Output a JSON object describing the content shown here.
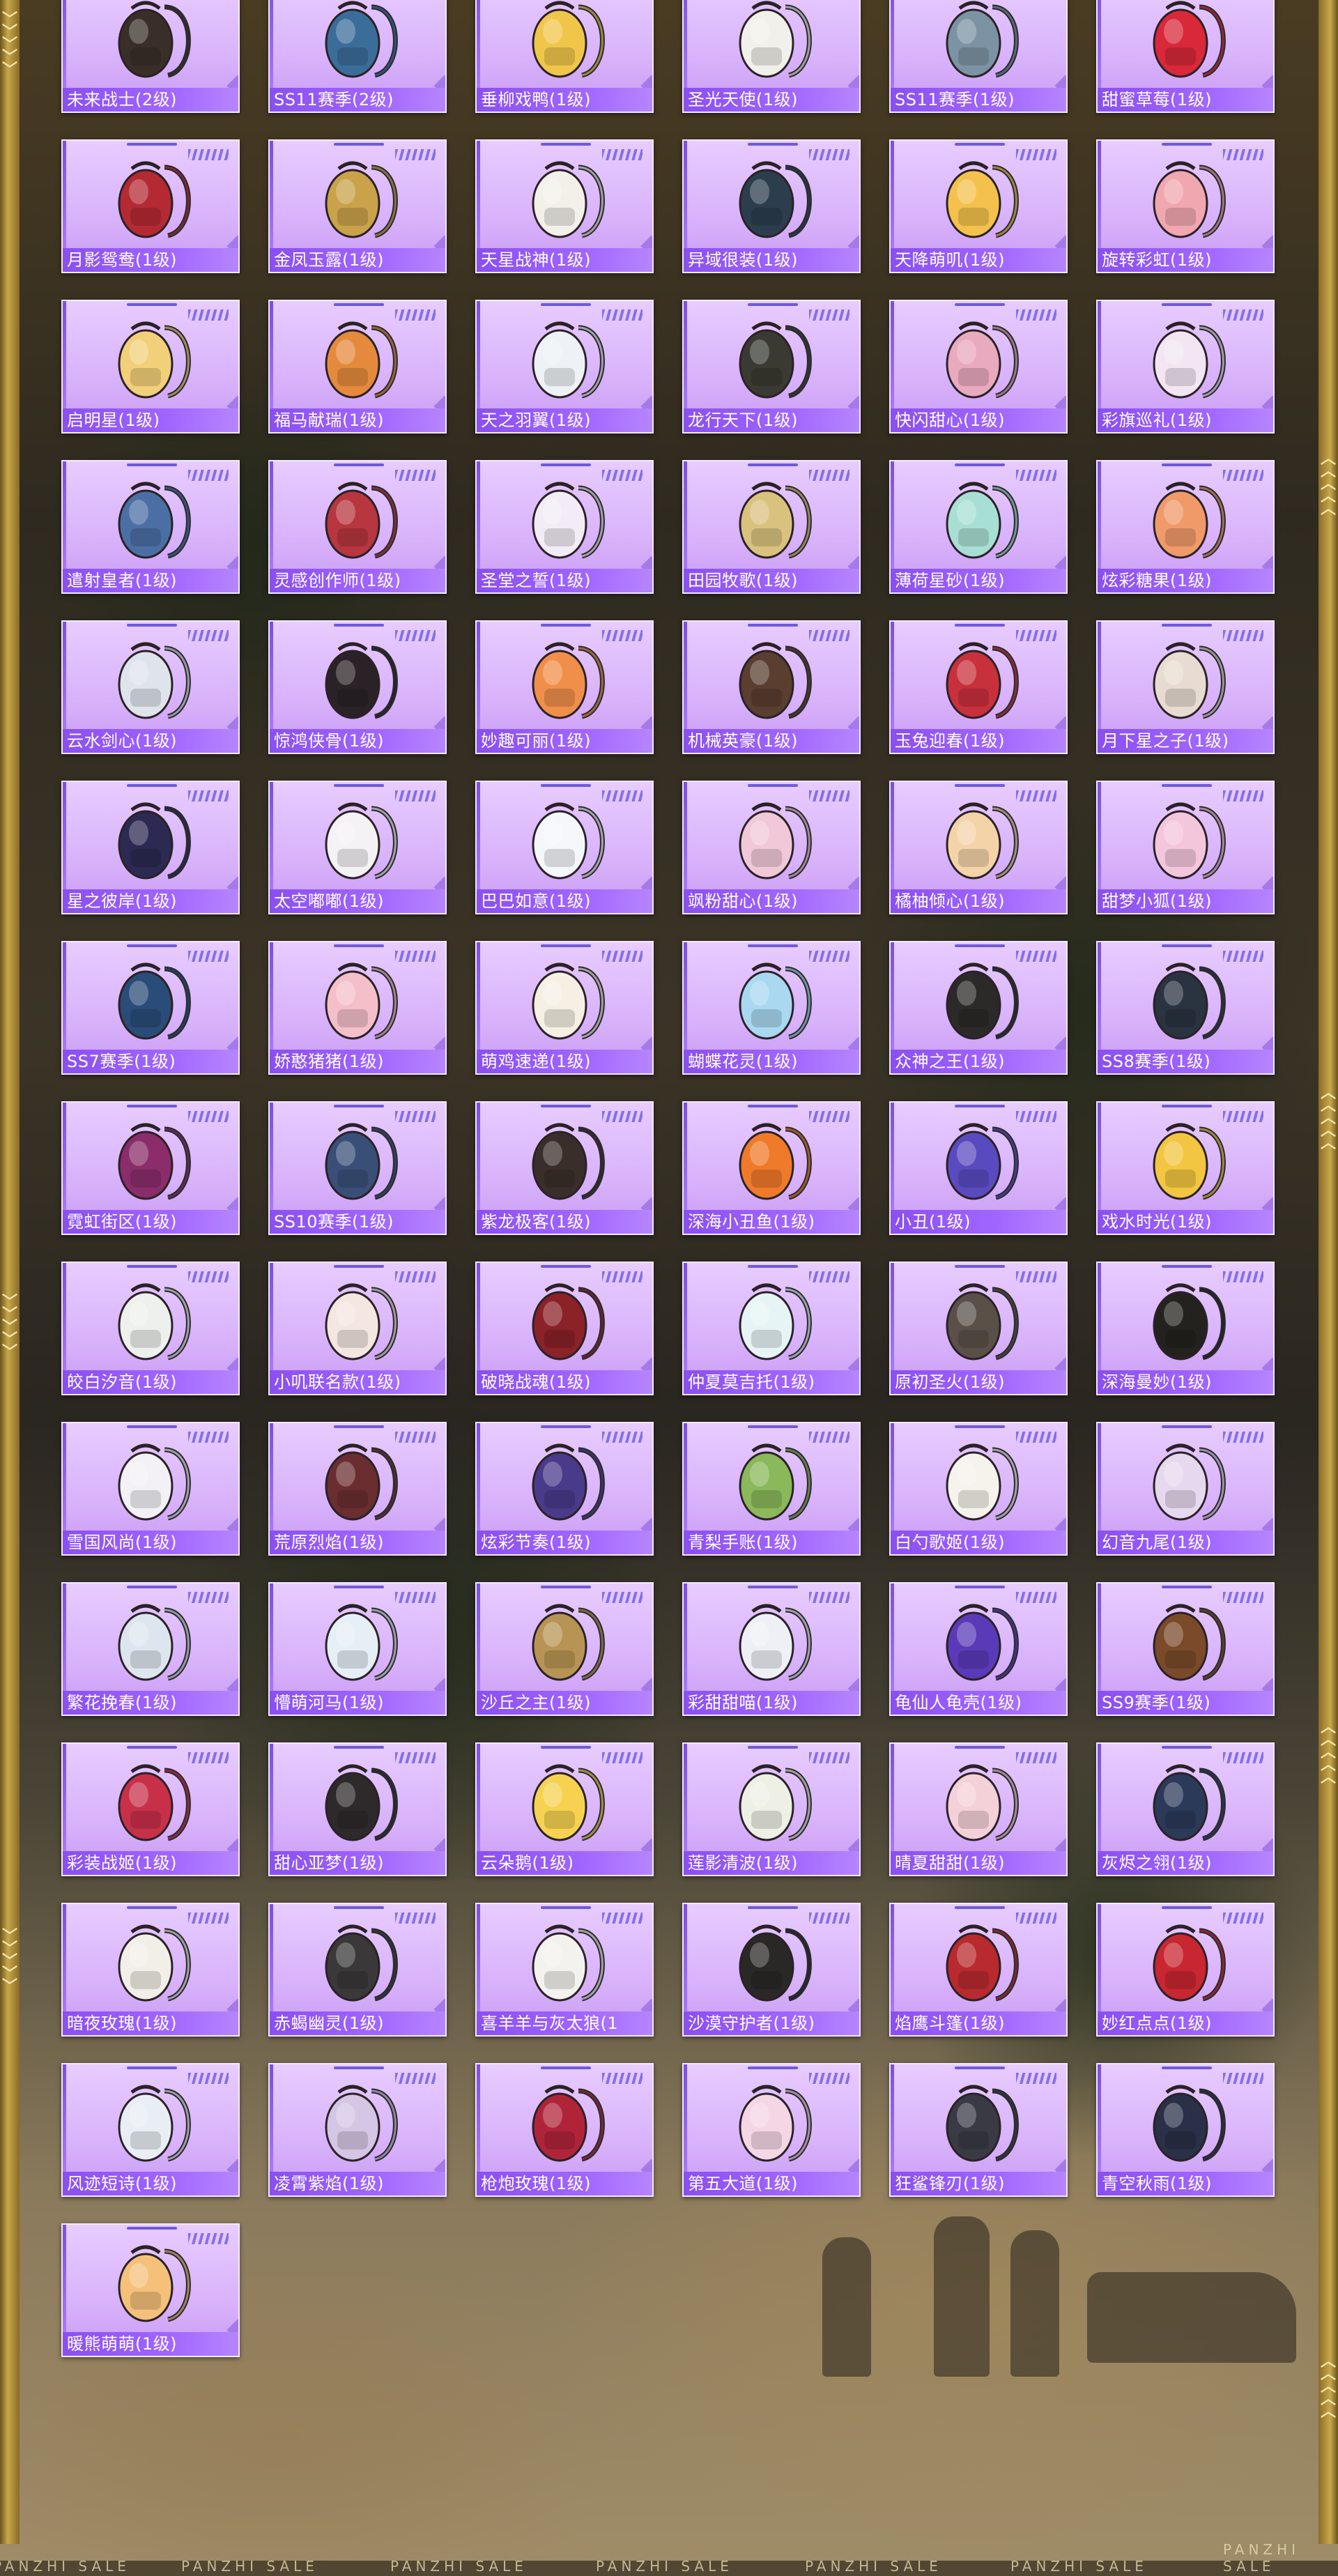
{
  "items": [
    {
      "label": "未来战士(2级)",
      "icon": "backpack-icon",
      "color": "#3a2f28"
    },
    {
      "label": "SS11赛季(2级)",
      "icon": "backpack-icon",
      "color": "#3b6d9a"
    },
    {
      "label": "垂柳戏鸭(1级)",
      "icon": "duck-backpack-icon",
      "color": "#f0c64a"
    },
    {
      "label": "圣光天使(1级)",
      "icon": "angel-backpack-icon",
      "color": "#f2f0ea"
    },
    {
      "label": "SS11赛季(1级)",
      "icon": "backpack-icon",
      "color": "#7c93a4"
    },
    {
      "label": "甜蜜草莓(1级)",
      "icon": "strawberry-backpack-icon",
      "color": "#d8283a"
    },
    {
      "label": "月影鸳鸯(1级)",
      "icon": "backpack-icon",
      "color": "#b42a33"
    },
    {
      "label": "金凤玉露(1级)",
      "icon": "backpack-icon",
      "color": "#c9a24a"
    },
    {
      "label": "天星战神(1级)",
      "icon": "backpack-icon",
      "color": "#f3f0ea"
    },
    {
      "label": "异域很装(1级)",
      "icon": "backpack-icon",
      "color": "#2c3e4e"
    },
    {
      "label": "天降萌叽(1级)",
      "icon": "chick-backpack-icon",
      "color": "#f4c24c"
    },
    {
      "label": "旋转彩虹(1级)",
      "icon": "backpack-icon",
      "color": "#f1a7b0"
    },
    {
      "label": "启明星(1级)",
      "icon": "backpack-icon",
      "color": "#f2d07a"
    },
    {
      "label": "福马献瑞(1级)",
      "icon": "horse-backpack-icon",
      "color": "#e58a3c"
    },
    {
      "label": "天之羽翼(1级)",
      "icon": "wing-backpack-icon",
      "color": "#eef2f6"
    },
    {
      "label": "龙行天下(1级)",
      "icon": "dragon-backpack-icon",
      "color": "#3a3a32"
    },
    {
      "label": "快闪甜心(1级)",
      "icon": "backpack-icon",
      "color": "#e9a9bf"
    },
    {
      "label": "彩旗巡礼(1级)",
      "icon": "backpack-icon",
      "color": "#f3e6f2"
    },
    {
      "label": "遣射皇者(1级)",
      "icon": "backpack-icon",
      "color": "#4b6fa4"
    },
    {
      "label": "灵感创作师(1级)",
      "icon": "checker-bag-icon",
      "color": "#b7363f"
    },
    {
      "label": "圣堂之誓(1级)",
      "icon": "heart-backpack-icon",
      "color": "#f3ecf6"
    },
    {
      "label": "田园牧歌(1级)",
      "icon": "basket-backpack-icon",
      "color": "#d9c27e"
    },
    {
      "label": "薄荷星砂(1级)",
      "icon": "backpack-icon",
      "color": "#a8dfd4"
    },
    {
      "label": "炫彩糖果(1级)",
      "icon": "donut-backpack-icon",
      "color": "#f09a6a"
    },
    {
      "label": "云水剑心(1级)",
      "icon": "sword-backpack-icon",
      "color": "#dfe4ec"
    },
    {
      "label": "惊鸿侠骨(1级)",
      "icon": "backpack-icon",
      "color": "#2a2226"
    },
    {
      "label": "妙趣可丽(1级)",
      "icon": "backpack-icon",
      "color": "#f08f4a"
    },
    {
      "label": "机械英豪(1级)",
      "icon": "backpack-icon",
      "color": "#5a3e30"
    },
    {
      "label": "玉兔迎春(1级)",
      "icon": "backpack-icon",
      "color": "#c8303c"
    },
    {
      "label": "月下星之子(1级)",
      "icon": "backpack-icon",
      "color": "#e8dcd2"
    },
    {
      "label": "星之彼岸(1级)",
      "icon": "helmet-backpack-icon",
      "color": "#2c2a52"
    },
    {
      "label": "太空嘟嘟(1级)",
      "icon": "ball-backpack-icon",
      "color": "#f5f2f6"
    },
    {
      "label": "巴巴如意(1级)",
      "icon": "bunny-backpack-icon",
      "color": "#f6f7fb"
    },
    {
      "label": "飒粉甜心(1级)",
      "icon": "backpack-icon",
      "color": "#f0c8d8"
    },
    {
      "label": "橘柚倾心(1级)",
      "icon": "orange-backpack-icon",
      "color": "#f4d3a8"
    },
    {
      "label": "甜梦小狐(1级)",
      "icon": "fox-backpack-icon",
      "color": "#f4c6dc"
    },
    {
      "label": "SS7赛季(1级)",
      "icon": "backpack-icon",
      "color": "#2a4c78"
    },
    {
      "label": "娇憨猪猪(1级)",
      "icon": "pig-backpack-icon",
      "color": "#f4bfc9"
    },
    {
      "label": "萌鸡速递(1级)",
      "icon": "chick-backpack-icon",
      "color": "#f6f0e4"
    },
    {
      "label": "蝴蝶花灵(1级)",
      "icon": "butterfly-backpack-icon",
      "color": "#a9d8f0"
    },
    {
      "label": "众神之王(1级)",
      "icon": "backpack-icon",
      "color": "#2c2a28"
    },
    {
      "label": "SS8赛季(1级)",
      "icon": "backpack-icon",
      "color": "#2a3340"
    },
    {
      "label": "霓虹街区(1级)",
      "icon": "backpack-icon",
      "color": "#8a2d6a"
    },
    {
      "label": "SS10赛季(1级)",
      "icon": "backpack-icon",
      "color": "#3a4f78"
    },
    {
      "label": "紫龙极客(1级)",
      "icon": "backpack-icon",
      "color": "#3a2e2a"
    },
    {
      "label": "深海小丑鱼(1级)",
      "icon": "clownfish-backpack-icon",
      "color": "#ef7a2a"
    },
    {
      "label": "小丑(1级)",
      "icon": "clown-backpack-icon",
      "color": "#5a4ac0"
    },
    {
      "label": "戏水时光(1级)",
      "icon": "duck-backpack-icon",
      "color": "#f2c640"
    },
    {
      "label": "皎白汐音(1级)",
      "icon": "shell-backpack-icon",
      "color": "#eef0ee"
    },
    {
      "label": "小叽联名款(1级)",
      "icon": "bunny-backpack-icon",
      "color": "#f4e6e0"
    },
    {
      "label": "破晓战魂(1级)",
      "icon": "backpack-icon",
      "color": "#8a2228"
    },
    {
      "label": "仲夏莫吉托(1级)",
      "icon": "cup-backpack-icon",
      "color": "#e6f4f6"
    },
    {
      "label": "原初圣火(1级)",
      "icon": "backpack-icon",
      "color": "#5a5048"
    },
    {
      "label": "深海曼妙(1级)",
      "icon": "backpack-icon",
      "color": "#24221e"
    },
    {
      "label": "雪国风尚(1级)",
      "icon": "bunny-backpack-icon",
      "color": "#f3f1f6"
    },
    {
      "label": "荒原烈焰(1级)",
      "icon": "backpack-icon",
      "color": "#6a2e30"
    },
    {
      "label": "炫彩节奏(1级)",
      "icon": "backpack-icon",
      "color": "#4a3a8a"
    },
    {
      "label": "青梨手账(1级)",
      "icon": "pear-backpack-icon",
      "color": "#8ab85a"
    },
    {
      "label": "白勺歌姬(1级)",
      "icon": "bunny-backpack-icon",
      "color": "#f6f2ec"
    },
    {
      "label": "幻音九尾(1级)",
      "icon": "crystal-backpack-icon",
      "color": "#e6d8ee"
    },
    {
      "label": "繁花挽春(1级)",
      "icon": "backpack-icon",
      "color": "#dde6ee"
    },
    {
      "label": "懵萌河马(1级)",
      "icon": "hippo-backpack-icon",
      "color": "#e6eef6"
    },
    {
      "label": "沙丘之主(1级)",
      "icon": "backpack-icon",
      "color": "#b89454"
    },
    {
      "label": "彩甜甜喵(1级)",
      "icon": "cat-backpack-icon",
      "color": "#eef0f6"
    },
    {
      "label": "龟仙人龟壳(1级)",
      "icon": "backpack-icon",
      "color": "#5a3ab8"
    },
    {
      "label": "SS9赛季(1级)",
      "icon": "backpack-icon",
      "color": "#7a4a2a"
    },
    {
      "label": "彩装战姬(1级)",
      "icon": "backpack-icon",
      "color": "#c8304a"
    },
    {
      "label": "甜心亚梦(1级)",
      "icon": "backpack-icon",
      "color": "#2e2a2c"
    },
    {
      "label": "云朵鹅(1级)",
      "icon": "flower-backpack-icon",
      "color": "#f6d250"
    },
    {
      "label": "莲影清波(1级)",
      "icon": "backpack-icon",
      "color": "#eef0e6"
    },
    {
      "label": "晴夏甜甜(1级)",
      "icon": "backpack-icon",
      "color": "#f4d0d8"
    },
    {
      "label": "灰烬之翎(1级)",
      "icon": "backpack-icon",
      "color": "#2c3a5a"
    },
    {
      "label": "暗夜玫瑰(1级)",
      "icon": "backpack-icon",
      "color": "#f2efe8"
    },
    {
      "label": "赤蝎幽灵(1级)",
      "icon": "backpack-icon",
      "color": "#3a3838"
    },
    {
      "label": "喜羊羊与灰太狼(1",
      "icon": "sheep-backpack-icon",
      "color": "#f4f2ee"
    },
    {
      "label": "沙漠守护者(1级)",
      "icon": "backpack-icon",
      "color": "#2a2826"
    },
    {
      "label": "焰鹰斗篷(1级)",
      "icon": "backpack-icon",
      "color": "#b82a2e"
    },
    {
      "label": "妙红点点(1级)",
      "icon": "backpack-icon",
      "color": "#c82630"
    },
    {
      "label": "风迹短诗(1级)",
      "icon": "backpack-icon",
      "color": "#e8eef4"
    },
    {
      "label": "凌霄紫焰(1级)",
      "icon": "backpack-icon",
      "color": "#d4c6e4"
    },
    {
      "label": "枪炮玫瑰(1级)",
      "icon": "backpack-icon",
      "color": "#b0243a"
    },
    {
      "label": "第五大道(1级)",
      "icon": "backpack-icon",
      "color": "#f4d6e4"
    },
    {
      "label": "狂鲨锋刃(1级)",
      "icon": "shark-backpack-icon",
      "color": "#3a3a44"
    },
    {
      "label": "青空秋雨(1级)",
      "icon": "backpack-icon",
      "color": "#2a3048"
    },
    {
      "label": "暖熊萌萌(1级)",
      "icon": "bear-backpack-icon",
      "color": "#f4c07a"
    }
  ],
  "watermark": "PANZHI SALE",
  "colors": {
    "card_bg": "#dcb6fc",
    "label_bg": "#9a5cfa",
    "frame_gold": "#c9a84a"
  }
}
